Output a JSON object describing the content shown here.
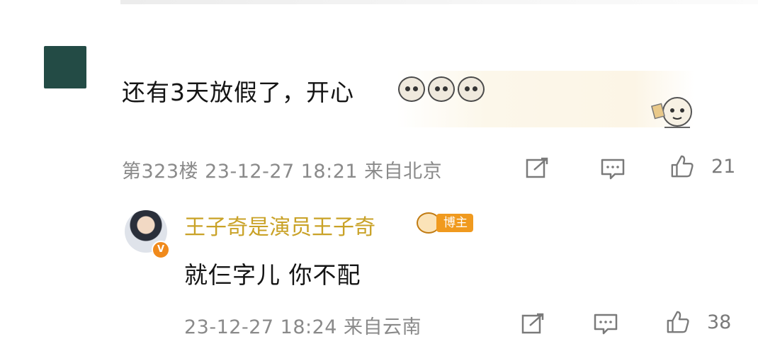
{
  "comment": {
    "text": "还有3天放假了，开心",
    "emojis": [
      "cat-emoji",
      "cat-emoji",
      "cat-emoji"
    ],
    "floor": "第323楼",
    "datetime": "23-12-27 18:21",
    "location": "来自北京",
    "meta_line": "第323楼  23-12-27 18:21  来自北京",
    "likes": "21"
  },
  "reply": {
    "author_name": "王子奇是演员王子奇",
    "badge_label": "博主",
    "verified_mark": "V",
    "text": "就仨字儿 你不配",
    "meta_line": "23-12-27 18:24  来自云南",
    "likes": "38"
  },
  "icons": {
    "share": "share-icon",
    "comment": "comment-icon",
    "like": "thumbs-up-icon"
  },
  "colors": {
    "author_name": "#c9a227",
    "meta_text": "#8a8a8a",
    "badge": "#f09a1f",
    "avatar": "#234b45"
  }
}
